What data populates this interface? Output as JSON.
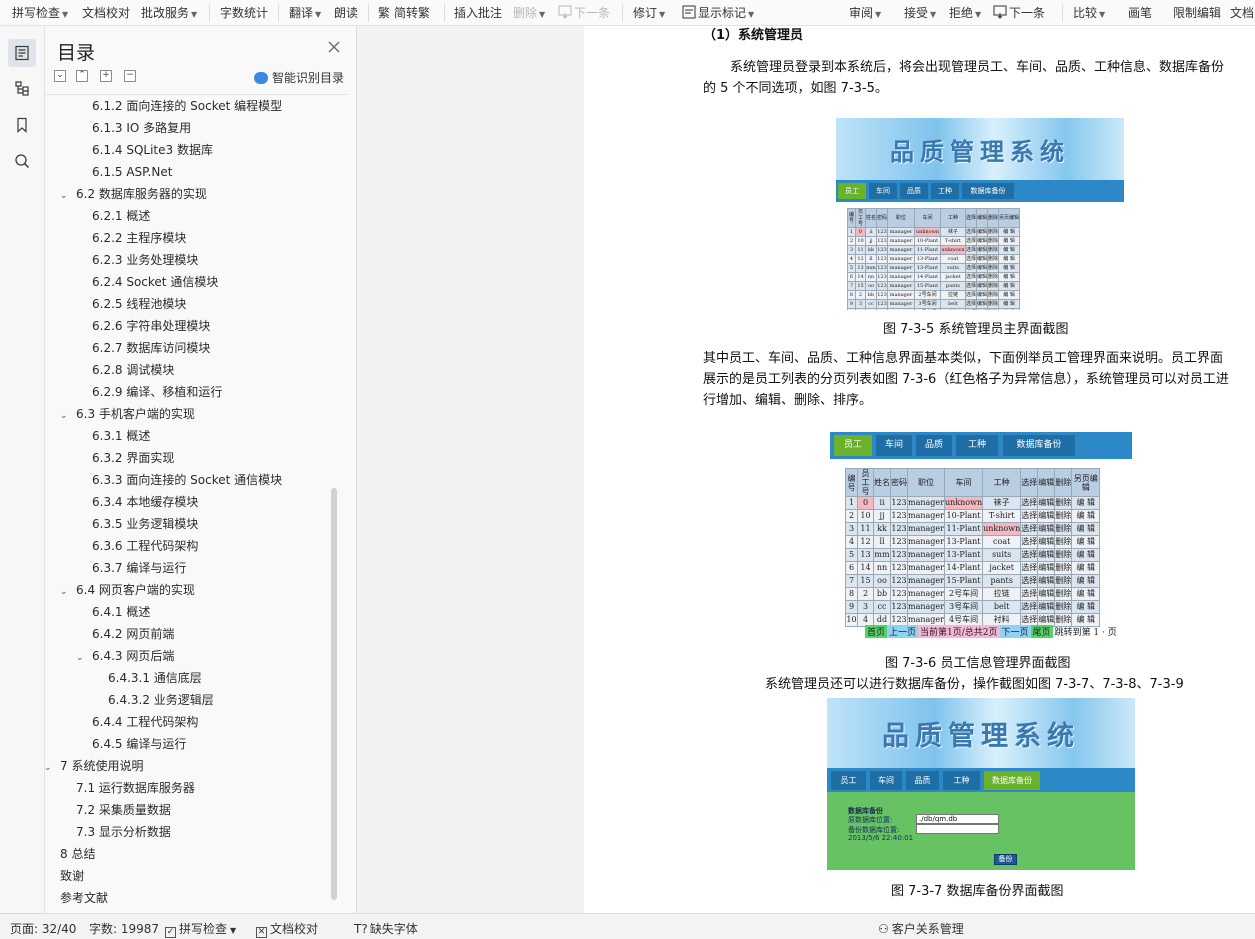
{
  "toolbar": {
    "spellcheck": "拼写检查",
    "doc_proofread": "文档校对",
    "review_service": "批改服务",
    "word_count": "字数统计",
    "translate": "翻译",
    "read_aloud": "朗读",
    "simp_trad": "简转繁",
    "insert_comment": "插入批注",
    "delete": "删除",
    "next_item": "下一条",
    "track_changes": "修订",
    "show_markup": "显示标记",
    "review": "审阅",
    "accept": "接受",
    "reject": "拒绝",
    "next_change": "下一条",
    "compare": "比较",
    "pen": "画笔",
    "restrict_edit": "限制编辑",
    "doc_more": "文档"
  },
  "toc": {
    "title": "目录",
    "smart_toc": "智能识别目录",
    "items": [
      {
        "label": "6.1.2 面向连接的 Socket 编程模型",
        "level": 3,
        "toggle": ""
      },
      {
        "label": "6.1.3 IO 多路复用",
        "level": 3,
        "toggle": ""
      },
      {
        "label": "6.1.4 SQLite3 数据库",
        "level": 3,
        "toggle": ""
      },
      {
        "label": "6.1.5 ASP.Net",
        "level": 3,
        "toggle": ""
      },
      {
        "label": "6.2 数据库服务器的实现",
        "level": 2,
        "toggle": "⌵"
      },
      {
        "label": "6.2.1 概述",
        "level": 3,
        "toggle": ""
      },
      {
        "label": "6.2.2 主程序模块",
        "level": 3,
        "toggle": ""
      },
      {
        "label": "6.2.3 业务处理模块",
        "level": 3,
        "toggle": ""
      },
      {
        "label": "6.2.4 Socket 通信模块",
        "level": 3,
        "toggle": ""
      },
      {
        "label": "6.2.5 线程池模块",
        "level": 3,
        "toggle": ""
      },
      {
        "label": "6.2.6 字符串处理模块",
        "level": 3,
        "toggle": ""
      },
      {
        "label": "6.2.7 数据库访问模块",
        "level": 3,
        "toggle": ""
      },
      {
        "label": "6.2.8 调试模块",
        "level": 3,
        "toggle": ""
      },
      {
        "label": "6.2.9  编译、移植和运行",
        "level": 3,
        "toggle": ""
      },
      {
        "label": "6.3 手机客户端的实现",
        "level": 2,
        "toggle": "⌵"
      },
      {
        "label": "6.3.1 概述",
        "level": 3,
        "toggle": ""
      },
      {
        "label": "6.3.2 界面实现",
        "level": 3,
        "toggle": ""
      },
      {
        "label": "6.3.3 面向连接的 Socket 通信模块",
        "level": 3,
        "toggle": ""
      },
      {
        "label": "6.3.4 本地缓存模块",
        "level": 3,
        "toggle": ""
      },
      {
        "label": "6.3.5 业务逻辑模块",
        "level": 3,
        "toggle": ""
      },
      {
        "label": "6.3.6 工程代码架构",
        "level": 3,
        "toggle": ""
      },
      {
        "label": "6.3.7 编译与运行",
        "level": 3,
        "toggle": ""
      },
      {
        "label": "6.4 网页客户端的实现",
        "level": 2,
        "toggle": "⌵"
      },
      {
        "label": "6.4.1 概述",
        "level": 3,
        "toggle": ""
      },
      {
        "label": "6.4.2 网页前端",
        "level": 3,
        "toggle": ""
      },
      {
        "label": "6.4.3 网页后端",
        "level": 3,
        "toggle": "⌵"
      },
      {
        "label": "6.4.3.1 通信底层",
        "level": 4,
        "toggle": ""
      },
      {
        "label": "6.4.3.2 业务逻辑层",
        "level": 4,
        "toggle": ""
      },
      {
        "label": "6.4.4 工程代码架构",
        "level": 3,
        "toggle": ""
      },
      {
        "label": "6.4.5 编译与运行",
        "level": 3,
        "toggle": ""
      },
      {
        "label": "7  系统使用说明",
        "level": 1,
        "toggle": "⌵"
      },
      {
        "label": "7.1 运行数据库服务器",
        "level": 2,
        "toggle": ""
      },
      {
        "label": "7.2 采集质量数据",
        "level": 2,
        "toggle": ""
      },
      {
        "label": "7.3 显示分析数据",
        "level": 2,
        "toggle": ""
      },
      {
        "label": "8 总结",
        "level": 1,
        "toggle": ""
      },
      {
        "label": "致谢",
        "level": 1,
        "toggle": ""
      },
      {
        "label": "参考文献",
        "level": 1,
        "toggle": ""
      }
    ]
  },
  "doc": {
    "heading": "（1）系统管理员",
    "para1_line1": "系统管理员登录到本系统后，将会出现管理员工、车间、品质、工种信息、数据库备份",
    "para1_line2": "的 5 个不同选项，如图 7-3-5。",
    "caption1": "图 7-3-5  系统管理员主界面截图",
    "para2_line1": "其中员工、车间、品质、工种信息界面基本类似，下面例举员工管理界面来说明。员工界面",
    "para2_line2": "展示的是员工列表的分页列表如图 7-3-6（红色格子为异常信息），系统管理员可以对员工进",
    "para2_line3": "行增加、编辑、删除、排序。",
    "caption2": "图 7-3-6 员工信息管理界面截图",
    "para3": "系统管理员还可以进行数据库备份，操作截图如图 7-3-7、7-3-8、7-3-9",
    "caption3": "图 7-3-7 数据库备份界面截图"
  },
  "app_ui": {
    "banner_title": "品质管理系统",
    "tabs": [
      "员工",
      "车间",
      "品质",
      "工种",
      "数据库备份"
    ],
    "table_headers": [
      "编号",
      "员工号",
      "姓名",
      "密码",
      "职位",
      "车间",
      "工种",
      "选择",
      "编辑",
      "删除",
      "另页编辑"
    ],
    "rows": [
      {
        "id": "1",
        "emp": "0",
        "name": "ii",
        "pwd": "123",
        "pos": "manager",
        "ws": "unknown",
        "job": "袜子",
        "bad_emp": true,
        "bad_ws": true,
        "bad_job": false
      },
      {
        "id": "2",
        "emp": "10",
        "name": "jj",
        "pwd": "123",
        "pos": "manager",
        "ws": "10-Plant",
        "job": "T-shirt",
        "bad_emp": false,
        "bad_ws": false,
        "bad_job": false
      },
      {
        "id": "3",
        "emp": "11",
        "name": "kk",
        "pwd": "123",
        "pos": "manager",
        "ws": "11-Plant",
        "job": "unknown",
        "bad_emp": false,
        "bad_ws": false,
        "bad_job": true
      },
      {
        "id": "4",
        "emp": "12",
        "name": "ll",
        "pwd": "123",
        "pos": "manager",
        "ws": "13-Plant",
        "job": "coat",
        "bad_emp": false,
        "bad_ws": false,
        "bad_job": false
      },
      {
        "id": "5",
        "emp": "13",
        "name": "mm",
        "pwd": "123",
        "pos": "manager",
        "ws": "13-Plant",
        "job": "suits",
        "bad_emp": false,
        "bad_ws": false,
        "bad_job": false
      },
      {
        "id": "6",
        "emp": "14",
        "name": "nn",
        "pwd": "123",
        "pos": "manager",
        "ws": "14-Plant",
        "job": "jacket",
        "bad_emp": false,
        "bad_ws": false,
        "bad_job": false
      },
      {
        "id": "7",
        "emp": "15",
        "name": "oo",
        "pwd": "123",
        "pos": "manager",
        "ws": "15-Plant",
        "job": "pants",
        "bad_emp": false,
        "bad_ws": false,
        "bad_job": false
      },
      {
        "id": "8",
        "emp": "2",
        "name": "bb",
        "pwd": "123",
        "pos": "manager",
        "ws": "2号车间",
        "job": "拉链",
        "bad_emp": false,
        "bad_ws": false,
        "bad_job": false
      },
      {
        "id": "9",
        "emp": "3",
        "name": "cc",
        "pwd": "123",
        "pos": "manager",
        "ws": "3号车间",
        "job": "belt",
        "bad_emp": false,
        "bad_ws": false,
        "bad_job": false
      },
      {
        "id": "10",
        "emp": "4",
        "name": "dd",
        "pwd": "123",
        "pos": "manager",
        "ws": "4号车间",
        "job": "衬料",
        "bad_emp": false,
        "bad_ws": false,
        "bad_job": false
      }
    ],
    "cell_select": "选择",
    "cell_edit": "编辑",
    "cell_delete": "删除",
    "cell_page_edit": "编 辑",
    "pager": {
      "first": "首页",
      "prev": "上一页",
      "current": "当前第1页/总共2页",
      "next": "下一页",
      "last": "尾页",
      "jump": "跳转到第 1 · 页"
    },
    "backup": {
      "title": "数据库备份",
      "src_label": "原数据库位置:",
      "src_value": "./db/qm.db",
      "dst_label": "备份数据库位置:",
      "time": "2013/5/6 22:40:01",
      "button": "备份"
    }
  },
  "status": {
    "page": "页面: 32/40",
    "words": "字数: 19987",
    "spellcheck": "拼写检查",
    "proofread": "文档校对",
    "missing_font": "缺失字体",
    "crm": "客户关系管理"
  },
  "colors": {
    "nav_blue": "#2c88c6",
    "tab_active": "#6ab22c",
    "error_cell": "#f4b8c0",
    "backup_bg": "#66c262"
  }
}
